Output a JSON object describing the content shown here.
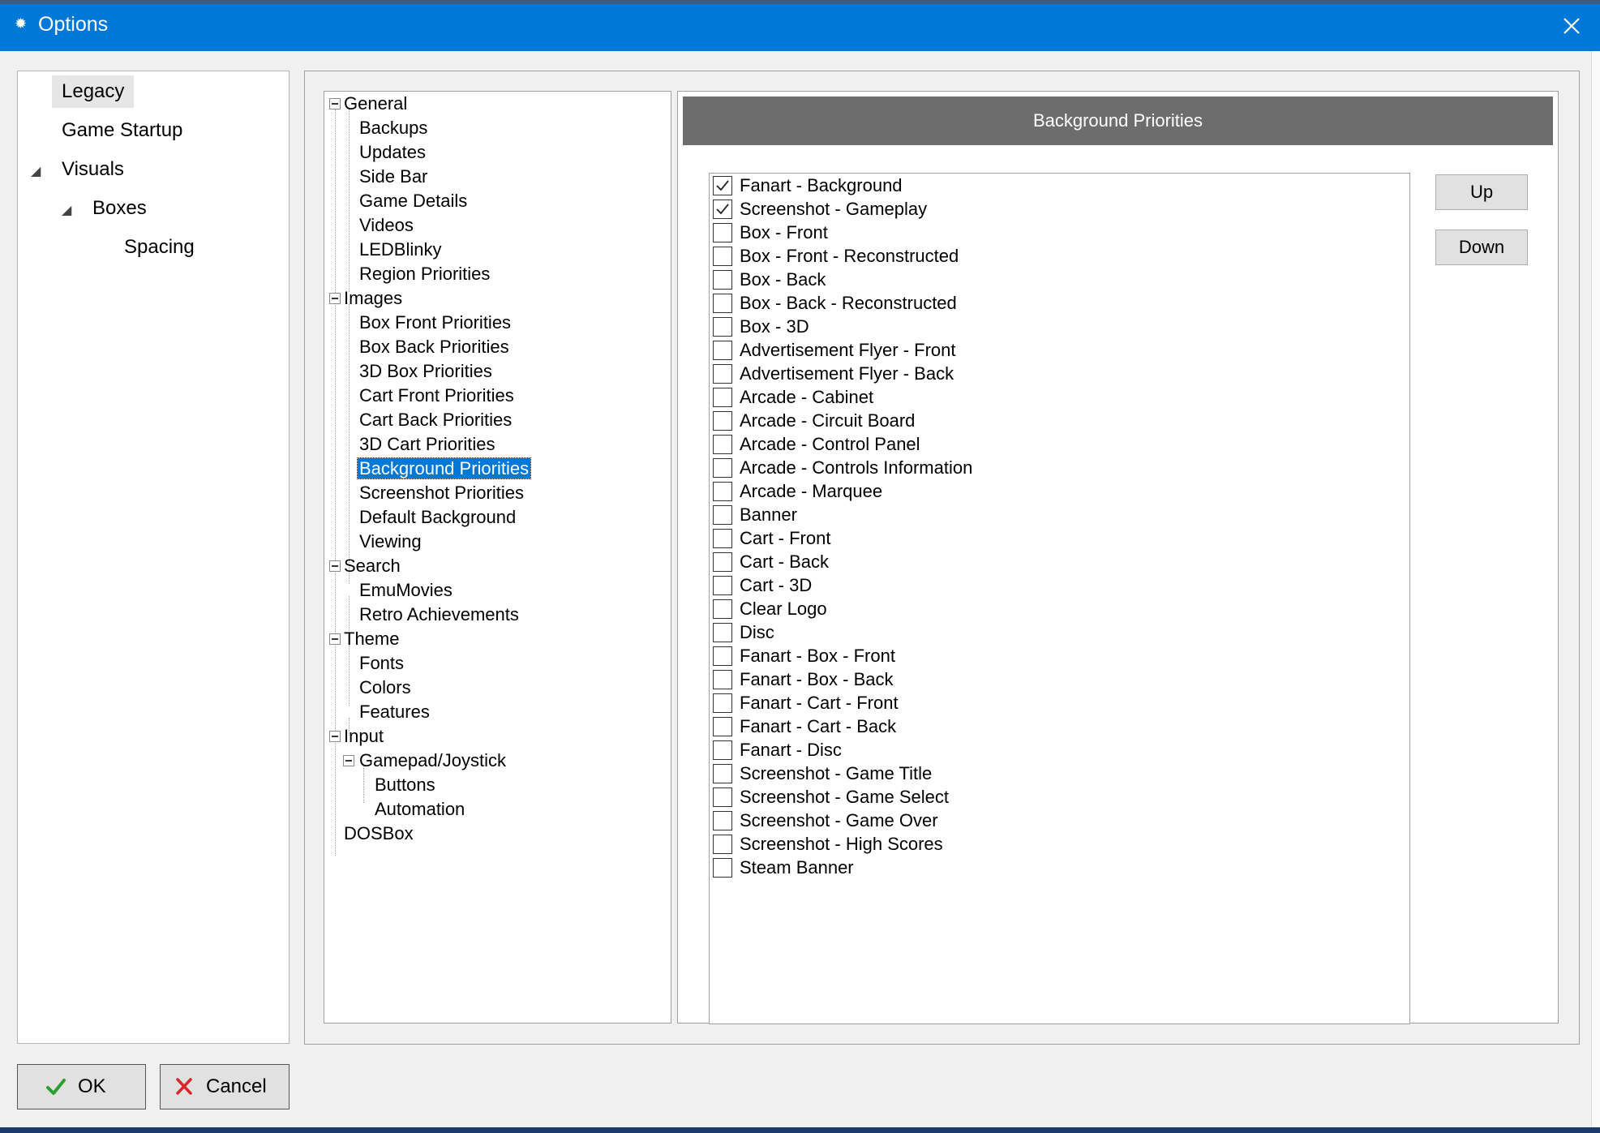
{
  "window": {
    "title": "Options",
    "close_label": "close"
  },
  "left_nav": {
    "items": [
      {
        "label": "Legacy",
        "selected": true
      },
      {
        "label": "Game Startup"
      },
      {
        "label": "Visuals",
        "expanded": true
      },
      {
        "label": "Boxes",
        "expanded": true
      },
      {
        "label": "Spacing"
      }
    ]
  },
  "tree": {
    "items": [
      {
        "label": "General"
      },
      {
        "label": "Backups"
      },
      {
        "label": "Updates"
      },
      {
        "label": "Side Bar"
      },
      {
        "label": "Game Details"
      },
      {
        "label": "Videos"
      },
      {
        "label": "LEDBlinky"
      },
      {
        "label": "Region Priorities"
      },
      {
        "label": "Images"
      },
      {
        "label": "Box Front Priorities"
      },
      {
        "label": "Box Back Priorities"
      },
      {
        "label": "3D Box Priorities"
      },
      {
        "label": "Cart Front Priorities"
      },
      {
        "label": "Cart Back Priorities"
      },
      {
        "label": "3D Cart Priorities"
      },
      {
        "label": "Background Priorities",
        "selected": true
      },
      {
        "label": "Screenshot Priorities"
      },
      {
        "label": "Default Background"
      },
      {
        "label": "Viewing"
      },
      {
        "label": "Search"
      },
      {
        "label": "EmuMovies"
      },
      {
        "label": "Retro Achievements"
      },
      {
        "label": "Theme"
      },
      {
        "label": "Fonts"
      },
      {
        "label": "Colors"
      },
      {
        "label": "Features"
      },
      {
        "label": "Input"
      },
      {
        "label": "Gamepad/Joystick"
      },
      {
        "label": "Buttons"
      },
      {
        "label": "Automation"
      },
      {
        "label": "DOSBox"
      }
    ]
  },
  "panel": {
    "header": "Background Priorities",
    "up_label": "Up",
    "down_label": "Down",
    "checklist": [
      {
        "label": "Fanart - Background",
        "checked": true
      },
      {
        "label": "Screenshot - Gameplay",
        "checked": true
      },
      {
        "label": "Box - Front",
        "checked": false
      },
      {
        "label": "Box - Front - Reconstructed",
        "checked": false
      },
      {
        "label": "Box - Back",
        "checked": false
      },
      {
        "label": "Box - Back - Reconstructed",
        "checked": false
      },
      {
        "label": "Box - 3D",
        "checked": false
      },
      {
        "label": "Advertisement Flyer - Front",
        "checked": false
      },
      {
        "label": "Advertisement Flyer - Back",
        "checked": false
      },
      {
        "label": "Arcade - Cabinet",
        "checked": false
      },
      {
        "label": "Arcade - Circuit Board",
        "checked": false
      },
      {
        "label": "Arcade - Control Panel",
        "checked": false
      },
      {
        "label": "Arcade - Controls Information",
        "checked": false
      },
      {
        "label": "Arcade - Marquee",
        "checked": false
      },
      {
        "label": "Banner",
        "checked": false
      },
      {
        "label": "Cart - Front",
        "checked": false
      },
      {
        "label": "Cart - Back",
        "checked": false
      },
      {
        "label": "Cart - 3D",
        "checked": false
      },
      {
        "label": "Clear Logo",
        "checked": false
      },
      {
        "label": "Disc",
        "checked": false
      },
      {
        "label": "Fanart - Box - Front",
        "checked": false
      },
      {
        "label": "Fanart - Box - Back",
        "checked": false
      },
      {
        "label": "Fanart - Cart - Front",
        "checked": false
      },
      {
        "label": "Fanart - Cart - Back",
        "checked": false
      },
      {
        "label": "Fanart - Disc",
        "checked": false
      },
      {
        "label": "Screenshot - Game Title",
        "checked": false
      },
      {
        "label": "Screenshot - Game Select",
        "checked": false
      },
      {
        "label": "Screenshot - Game Over",
        "checked": false
      },
      {
        "label": "Screenshot - High Scores",
        "checked": false
      },
      {
        "label": "Steam Banner",
        "checked": false
      }
    ]
  },
  "footer": {
    "ok_label": "OK",
    "cancel_label": "Cancel"
  },
  "colors": {
    "titlebar": "#0078d7",
    "selection": "#0078d7",
    "header_bar": "#6d6d6d",
    "ok_icon": "#2e9e2e",
    "cancel_icon": "#d9262b"
  }
}
